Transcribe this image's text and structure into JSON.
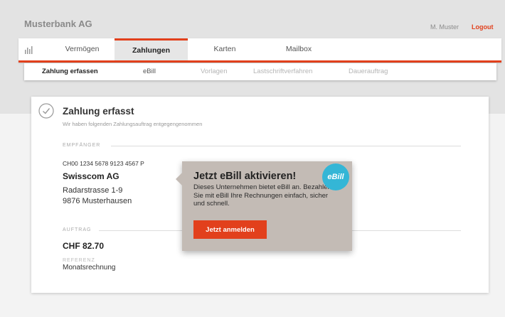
{
  "header": {
    "app_title": "Musterbank AG",
    "user_name": "M. Muster",
    "logout_label": "Logout"
  },
  "main_nav": {
    "icon": "bar-chart-icon",
    "tabs": [
      {
        "label": "Vermögen",
        "active": false
      },
      {
        "label": "Zahlungen",
        "active": true
      },
      {
        "label": "Karten",
        "active": false
      },
      {
        "label": "Mailbox",
        "active": false
      }
    ]
  },
  "sub_nav": {
    "tabs": [
      {
        "label": "Zahlung erfassen",
        "active": true
      },
      {
        "label": "eBill",
        "active": false
      },
      {
        "label": "Vorlagen",
        "active": false
      },
      {
        "label": "Lastschriftverfahren",
        "active": false
      },
      {
        "label": "Dauerauftrag",
        "active": false
      }
    ]
  },
  "confirmation": {
    "icon": "checkmark-circle-icon",
    "title": "Zahlung erfasst",
    "subtitle": "Wir haben folgenden Zahlungsauftrag entgegengenommen"
  },
  "recipient": {
    "section_label": "EMPFÄNGER",
    "iban": "CH00 1234 5678 9123 4567 P",
    "name": "Swisscom AG",
    "street": "Radarstrasse 1-9",
    "city": "9876 Musterhausen"
  },
  "order": {
    "section_label": "AUFTRAG",
    "amount": "CHF 82.70",
    "reference_label": "REFERENZ",
    "reference_value": "Monatsrechnung"
  },
  "ebill_popup": {
    "title": "Jetzt eBill aktivieren!",
    "body": "Dieses Unternehmen bietet eBill an. Bezahlen Sie mit eBill Ihre Rechnungen einfach, sicher und schnell.",
    "badge": "eBill",
    "button_label": "Jetzt anmelden"
  },
  "colors": {
    "accent": "#e2401c",
    "popup_bg": "#c3bbb5",
    "ebill_badge": "#34b6d6"
  }
}
